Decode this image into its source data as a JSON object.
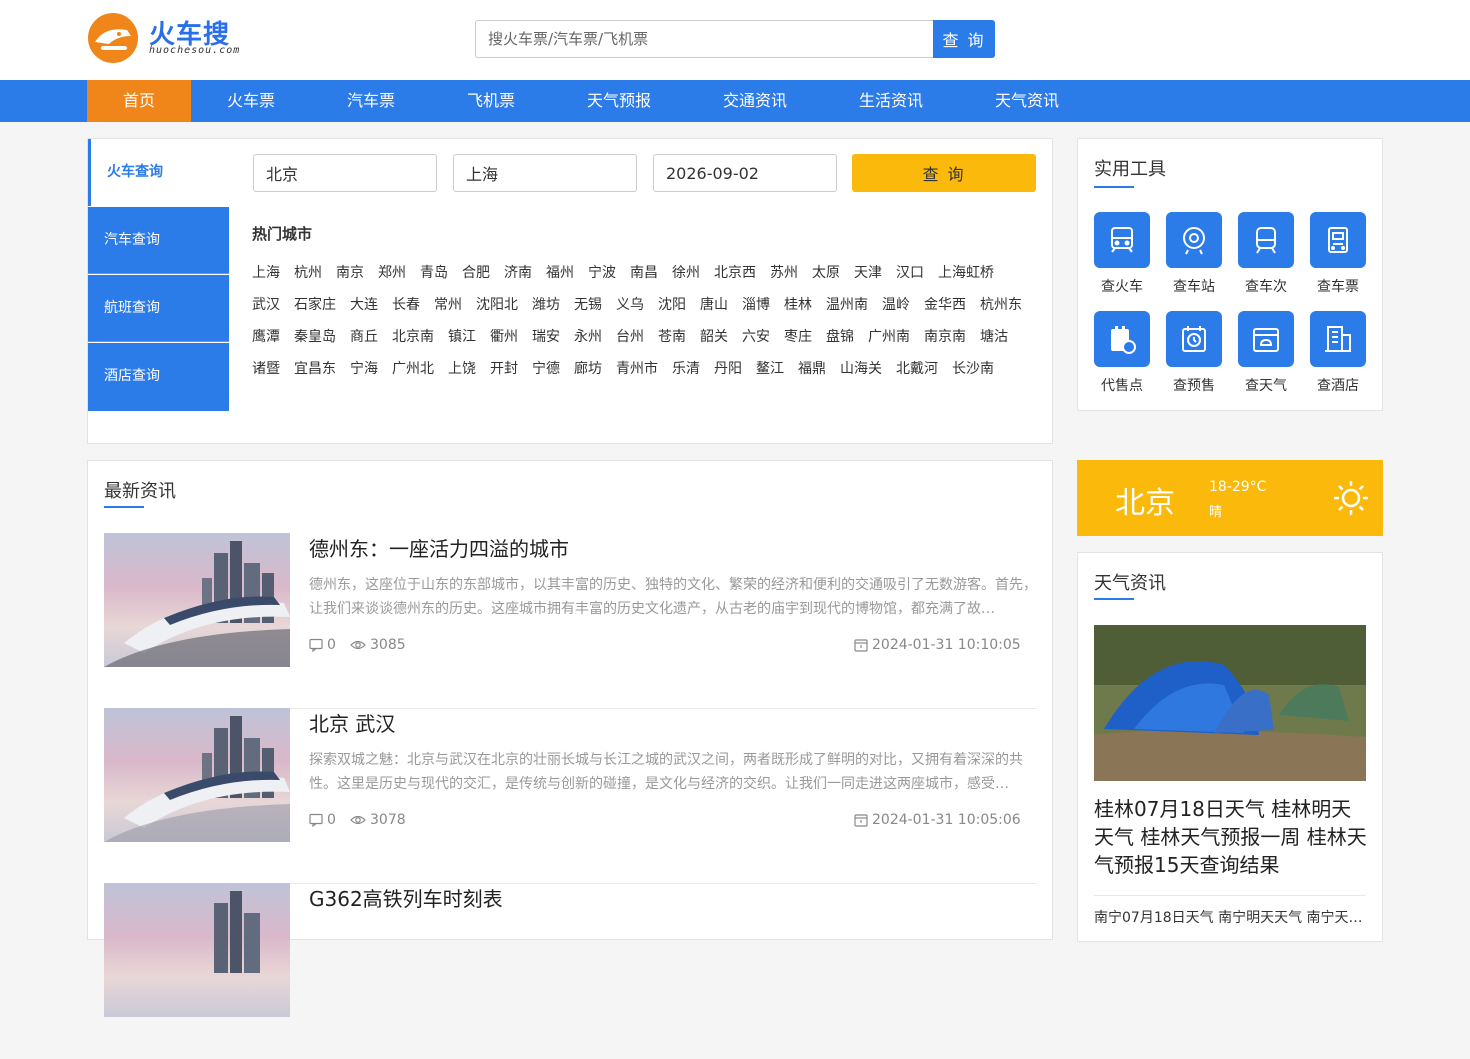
{
  "header": {
    "logo_text": "火车搜",
    "logo_sub": "huochesou.com",
    "search_placeholder": "搜火车票/汽车票/飞机票",
    "search_button": "查 询"
  },
  "nav": {
    "items": [
      "首页",
      "火车票",
      "汽车票",
      "飞机票",
      "天气预报",
      "交通资讯",
      "生活资讯",
      "天气资讯"
    ],
    "active_index": 0
  },
  "query": {
    "tabs": [
      "火车查询",
      "汽车查询",
      "航班查询",
      "酒店查询"
    ],
    "active_tab": 0,
    "from_value": "北京",
    "to_value": "上海",
    "date_value": "2026-09-02",
    "submit_label": "查 询",
    "hot_title": "热门城市",
    "hot_cities": [
      "上海",
      "杭州",
      "南京",
      "郑州",
      "青岛",
      "合肥",
      "济南",
      "福州",
      "宁波",
      "南昌",
      "徐州",
      "北京西",
      "苏州",
      "太原",
      "天津",
      "汉口",
      "上海虹桥",
      "武汉",
      "石家庄",
      "大连",
      "长春",
      "常州",
      "沈阳北",
      "潍坊",
      "无锡",
      "义乌",
      "沈阳",
      "唐山",
      "淄博",
      "桂林",
      "温州南",
      "温岭",
      "金华西",
      "杭州东",
      "鹰潭",
      "秦皇岛",
      "商丘",
      "北京南",
      "镇江",
      "衢州",
      "瑞安",
      "永州",
      "台州",
      "苍南",
      "韶关",
      "六安",
      "枣庄",
      "盘锦",
      "广州南",
      "南京南",
      "塘沽",
      "诸暨",
      "宜昌东",
      "宁海",
      "广州北",
      "上饶",
      "开封",
      "宁德",
      "廊坊",
      "青州市",
      "乐清",
      "丹阳",
      "鳌江",
      "福鼎",
      "山海关",
      "北戴河",
      "长沙南"
    ]
  },
  "tools": {
    "title": "实用工具",
    "items": [
      {
        "label": "查火车",
        "icon": "train-icon"
      },
      {
        "label": "查车站",
        "icon": "station-icon"
      },
      {
        "label": "查车次",
        "icon": "train-number-icon"
      },
      {
        "label": "查车票",
        "icon": "ticket-icon"
      },
      {
        "label": "代售点",
        "icon": "agency-icon"
      },
      {
        "label": "查预售",
        "icon": "presale-clock-icon"
      },
      {
        "label": "查天气",
        "icon": "weather-calendar-icon"
      },
      {
        "label": "查酒店",
        "icon": "hotel-icon"
      }
    ]
  },
  "weather": {
    "city": "北京",
    "temp": "18-29°C",
    "condition": "晴"
  },
  "news": {
    "title": "最新资讯",
    "items": [
      {
        "title": "德州东：一座活力四溢的城市",
        "desc": "德州东，这座位于山东的东部城市，以其丰富的历史、独特的文化、繁荣的经济和便利的交通吸引了无数游客。首先，让我们来谈谈德州东的历史。这座城市拥有丰富的历史文化遗产，从古老的庙宇到现代的博物馆，都充满了故…",
        "comments": "0",
        "views": "3085",
        "time": "2024-01-31 10:10:05"
      },
      {
        "title": "北京 武汉",
        "desc": "探索双城之魅：北京与武汉在北京的壮丽长城与长江之城的武汉之间，两者既形成了鲜明的对比，又拥有着深深的共性。这里是历史与现代的交汇，是传统与创新的碰撞，是文化与经济的交织。让我们一同走进这两座城市，感受…",
        "comments": "0",
        "views": "3078",
        "time": "2024-01-31 10:05:06"
      },
      {
        "title": "G362高铁列车时刻表",
        "desc": "",
        "comments": "",
        "views": "",
        "time": ""
      }
    ]
  },
  "weather_news": {
    "title": "天气资讯",
    "headline": "桂林07月18日天气 桂林明天天气 桂林天气预报一周 桂林天气预报15天查询结果",
    "sub": "南宁07月18日天气 南宁明天天气 南宁天…"
  },
  "colors": {
    "primary": "#2b7be8",
    "orange": "#f08519",
    "yellow": "#fbb90c"
  }
}
